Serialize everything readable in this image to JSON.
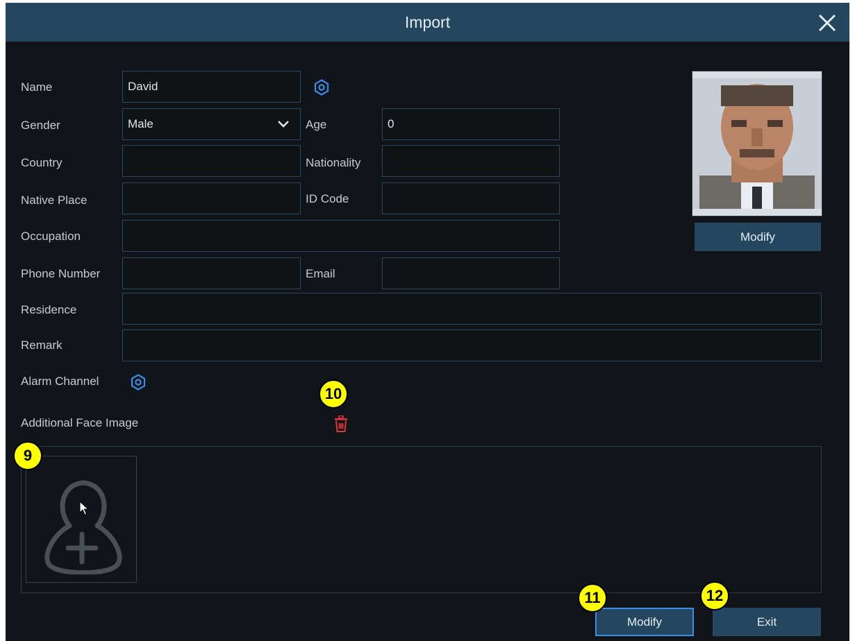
{
  "dialog": {
    "title": "Import",
    "close_icon": "close-icon"
  },
  "form": {
    "name": {
      "label": "Name",
      "value": "David"
    },
    "gender": {
      "label": "Gender",
      "value": "Male"
    },
    "age": {
      "label": "Age",
      "value": "0"
    },
    "country": {
      "label": "Country",
      "value": ""
    },
    "nationality": {
      "label": "Nationality",
      "value": ""
    },
    "native_place": {
      "label": "Native Place",
      "value": ""
    },
    "id_code": {
      "label": "ID Code",
      "value": ""
    },
    "occupation": {
      "label": "Occupation",
      "value": ""
    },
    "phone": {
      "label": "Phone Number",
      "value": ""
    },
    "email": {
      "label": "Email",
      "value": ""
    },
    "residence": {
      "label": "Residence",
      "value": ""
    },
    "remark": {
      "label": "Remark",
      "value": ""
    },
    "alarm_channel": {
      "label": "Alarm Channel"
    },
    "additional_face": {
      "label": "Additional Face Image"
    }
  },
  "photo": {
    "modify_label": "Modify"
  },
  "footer": {
    "modify_label": "Modify",
    "exit_label": "Exit"
  },
  "annotations": {
    "b9": "9",
    "b10": "10",
    "b11": "11",
    "b12": "12"
  },
  "colors": {
    "accent": "#3a8ee6",
    "delete": "#e0353b",
    "button": "#24465e",
    "highlight": "#ffff00"
  }
}
